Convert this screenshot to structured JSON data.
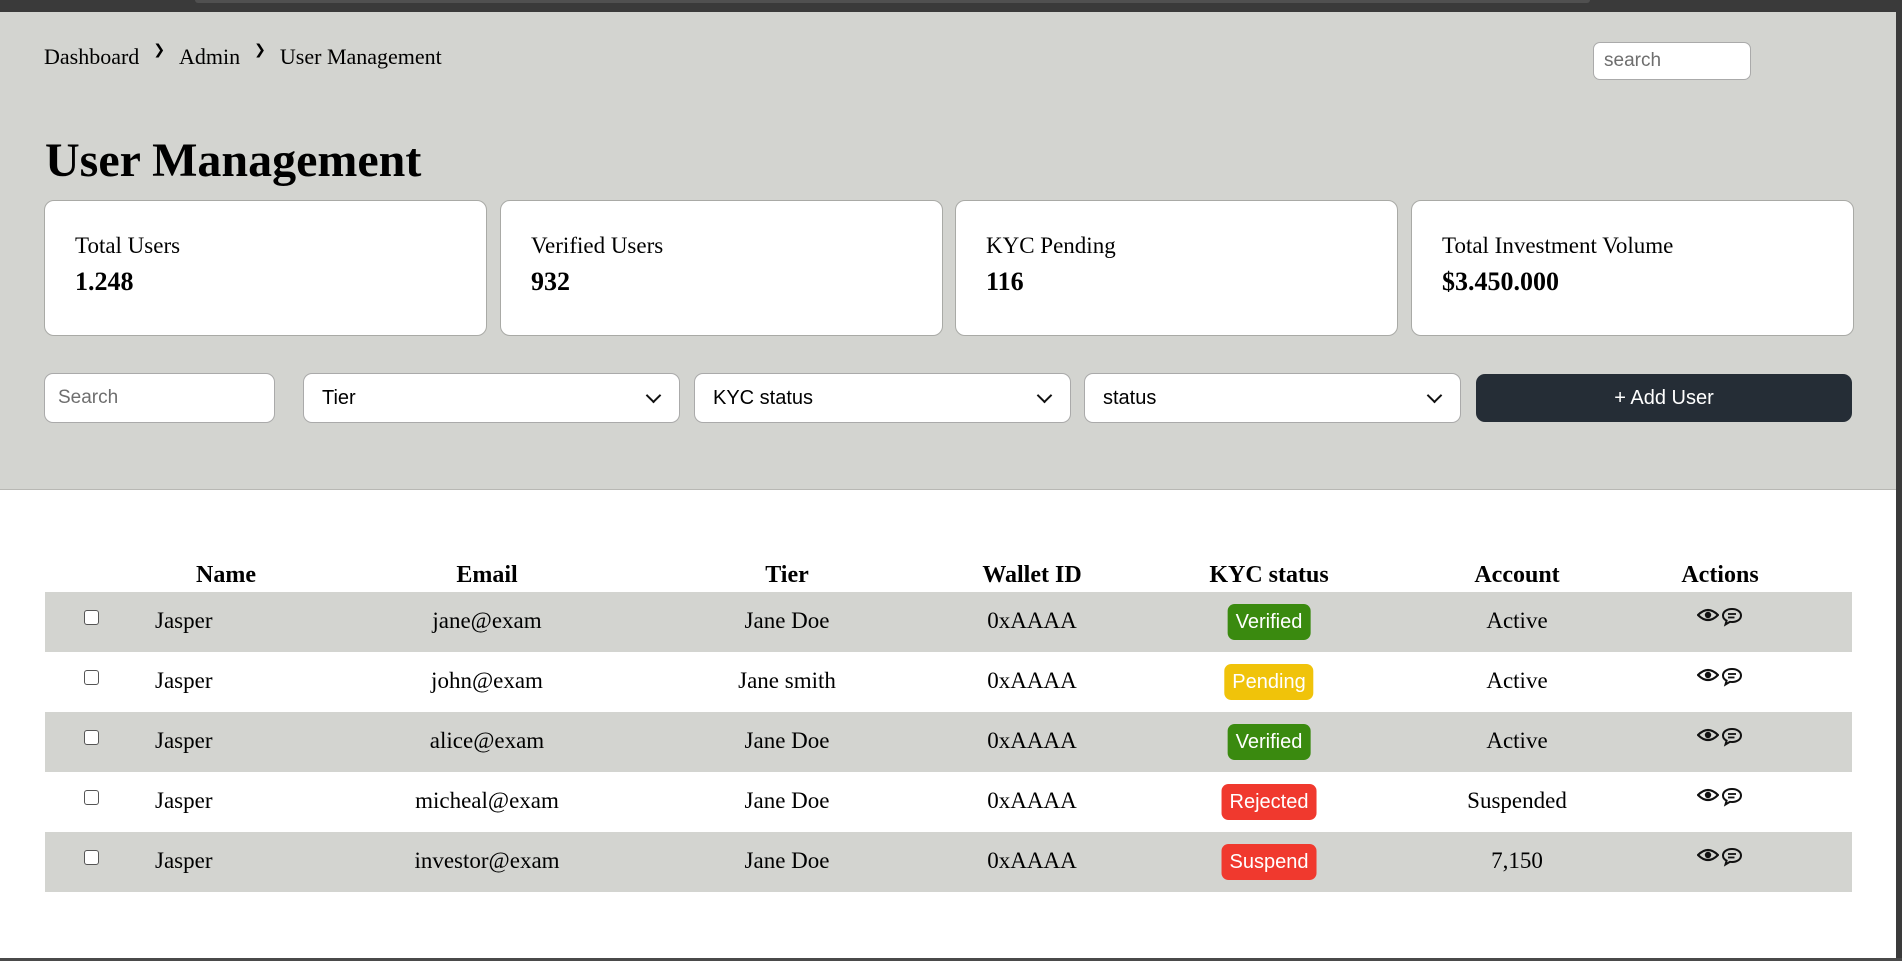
{
  "breadcrumb": [
    "Dashboard",
    "Admin",
    "User Management"
  ],
  "top_search": {
    "placeholder": "search"
  },
  "page_title": "User Management",
  "stats": [
    {
      "label": "Total Users",
      "value": "1.248"
    },
    {
      "label": "Verified Users",
      "value": "932"
    },
    {
      "label": "KYC Pending",
      "value": "116"
    },
    {
      "label": "Total Investment Volume",
      "value": "$3.450.000"
    }
  ],
  "filters": {
    "search_placeholder": "Search",
    "tier": "Tier",
    "kyc": "KYC status",
    "status": "status",
    "add_button": "+ Add User"
  },
  "table": {
    "headers": [
      "Name",
      "Email",
      "Tier",
      "Wallet ID",
      "KYC status",
      "Account",
      "Actions"
    ],
    "rows": [
      {
        "name": "Jasper",
        "email": "jane@exam",
        "tier": "Jane Doe",
        "wallet": "0xAAAA",
        "kyc": "Verified",
        "account": "Active"
      },
      {
        "name": "Jasper",
        "email": "john@exam",
        "tier": "Jane smith",
        "wallet": "0xAAAA",
        "kyc": "Pending",
        "account": "Active"
      },
      {
        "name": "Jasper",
        "email": "alice@exam",
        "tier": "Jane Doe",
        "wallet": "0xAAAA",
        "kyc": "Verified",
        "account": "Active"
      },
      {
        "name": "Jasper",
        "email": "micheal@exam",
        "tier": "Jane Doe",
        "wallet": "0xAAAA",
        "kyc": "Rejected",
        "account": "Suspended"
      },
      {
        "name": "Jasper",
        "email": "investor@exam",
        "tier": "Jane Doe",
        "wallet": "0xAAAA",
        "kyc": "Suspend",
        "account": "7,150"
      }
    ],
    "action_icons": [
      "eye-icon",
      "chat-icon"
    ]
  },
  "colors": {
    "header_bg": "#d3d4d0",
    "button_bg": "#252d36",
    "verified": "#3a8a0f",
    "pending": "#f0c30a",
    "rejected": "#f0392e",
    "suspend": "#f0392e"
  }
}
